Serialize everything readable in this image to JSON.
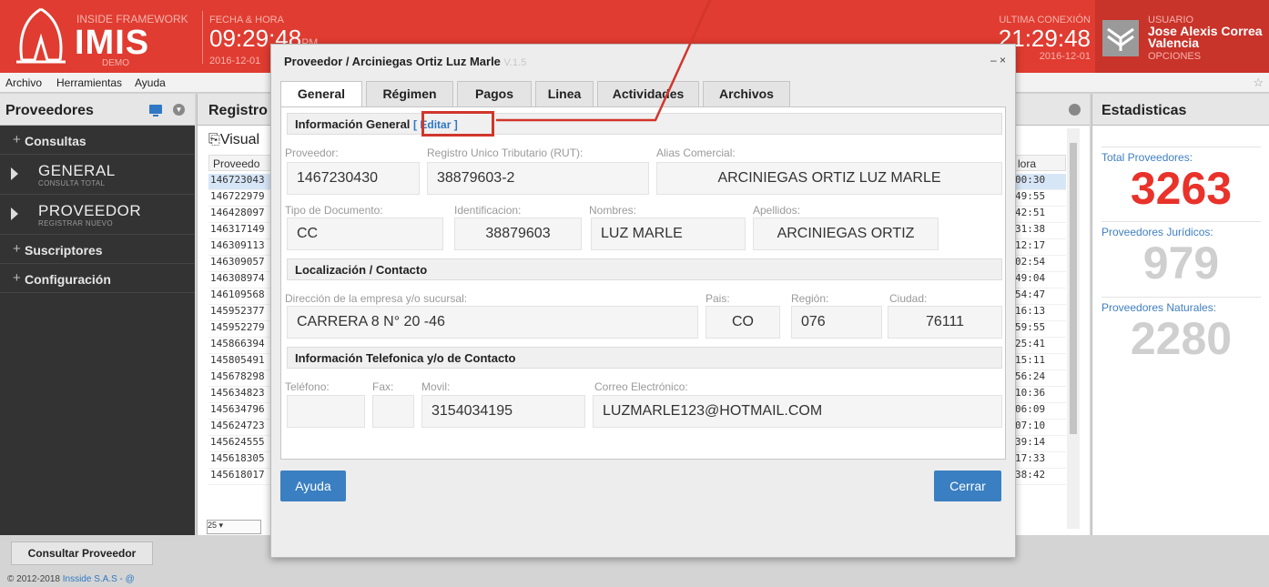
{
  "header": {
    "framework_label": "INSIDE FRAMEWORK",
    "app_name": "IMIS",
    "demo_label": "DEMO",
    "datetime_label": "FECHA & HORA",
    "time": "09:29:48",
    "time_suffix": "PM",
    "date": "2016-12-01",
    "last_conn_label": "ULTIMA CONEXIÓN",
    "last_conn_time": "21:29:48",
    "last_conn_date": "2016-12-01",
    "user_label": "USUARIO",
    "user_name": "Jose Alexis Correa Valencia",
    "options_label": "OPCIONES",
    "brand_color": "#e03c31"
  },
  "menu": {
    "file": "Archivo",
    "tools": "Herramientas",
    "help": "Ayuda",
    "spinner": "☆"
  },
  "sidebar": {
    "title": "Proveedores",
    "sections": [
      {
        "label": "Consultas"
      },
      {
        "label": "Suscriptores"
      },
      {
        "label": "Configuración"
      }
    ],
    "items": [
      {
        "title": "GENERAL",
        "subtitle": "CONSULTA TOTAL"
      },
      {
        "title": "PROVEEDOR",
        "subtitle": "REGISTRAR NUEVO"
      }
    ]
  },
  "center": {
    "title": "Registro",
    "visual_label": "Visual",
    "col_left": "Proveedo",
    "col_right": "lora",
    "rows_left": [
      "146723043",
      "146722979",
      "146428097",
      "146317149",
      "146309113",
      "146309057",
      "146308974",
      "146109568",
      "145952377",
      "145952279",
      "145866394",
      "145805491",
      "145678298",
      "145634823",
      "145634796",
      "145624723",
      "145624555",
      "145618305",
      "145618017"
    ],
    "rows_right": [
      "00:30",
      "49:55",
      "42:51",
      "31:38",
      "12:17",
      "02:54",
      "49:04",
      "54:47",
      "16:13",
      "59:55",
      "25:41",
      "15:11",
      "56:24",
      "10:36",
      "06:09",
      "07:10",
      "39:14",
      "17:33",
      "38:42"
    ],
    "page_size": "25"
  },
  "stats": {
    "title": "Estadisticas",
    "items": [
      {
        "label": "Total Proveedores:",
        "value": "3263",
        "color": "#e8322a"
      },
      {
        "label": "Proveedores Jurídicos:",
        "value": "979",
        "color": "#cfcfcf"
      },
      {
        "label": "Proveedores Naturales:",
        "value": "2280",
        "color": "#cfcfcf"
      }
    ]
  },
  "footer": {
    "consult_button": "Consultar Proveedor",
    "copyright": "© 2012-2018 ",
    "company": "Insside S.A.S - @"
  },
  "modal": {
    "title": "Proveedor / Arciniegas Ortiz Luz Marle",
    "version": "V.1.5",
    "controls": "– ×",
    "tabs": [
      "General",
      "Régimen",
      "Pagos",
      "Linea",
      "Actividades",
      "Archivos"
    ],
    "section_general": "Información General",
    "edit_open": "[",
    "edit_label": "Editar",
    "edit_close": "]",
    "section_location": "Localización / Contacto",
    "section_phone": "Información Telefonica y/o de Contacto",
    "fields": {
      "proveedor": {
        "label": "Proveedor:",
        "value": "1467230430"
      },
      "rut": {
        "label": "Registro Unico Tributario (RUT):",
        "value": "38879603-2"
      },
      "alias": {
        "label": "Alias Comercial:",
        "value": "ARCINIEGAS ORTIZ LUZ MARLE"
      },
      "tipo_doc": {
        "label": "Tipo de Documento:",
        "value": "CC"
      },
      "identificacion": {
        "label": "Identificacion:",
        "value": "38879603"
      },
      "nombres": {
        "label": "Nombres:",
        "value": "LUZ MARLE"
      },
      "apellidos": {
        "label": "Apellidos:",
        "value": "ARCINIEGAS ORTIZ"
      },
      "direccion": {
        "label": "Dirección de la empresa y/o sucursal:",
        "value": "CARRERA 8 N° 20 -46"
      },
      "pais": {
        "label": "Pais:",
        "value": "CO"
      },
      "region": {
        "label": "Región:",
        "value": "076"
      },
      "ciudad": {
        "label": "Ciudad:",
        "value": "76111"
      },
      "telefono": {
        "label": "Teléfono:",
        "value": ""
      },
      "fax": {
        "label": "Fax:",
        "value": ""
      },
      "movil": {
        "label": "Movil:",
        "value": "3154034195"
      },
      "correo": {
        "label": "Correo Electrónico:",
        "value": "LUZMARLE123@HOTMAIL.COM"
      }
    },
    "help_button": "Ayuda",
    "close_button": "Cerrar"
  }
}
